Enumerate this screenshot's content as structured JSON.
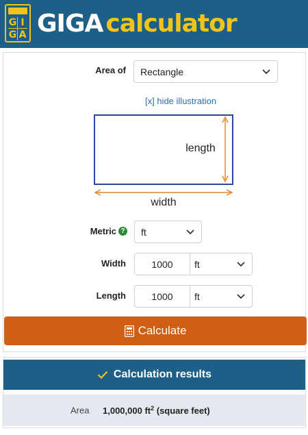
{
  "header": {
    "logo_letters": [
      "G",
      "I",
      "G",
      "A"
    ],
    "brand_part1": "GIGA",
    "brand_part2": "calculator"
  },
  "form": {
    "area_of_label": "Area of",
    "area_of_value": "Rectangle",
    "toggle_link": "[x] hide illustration",
    "illustration": {
      "length_label": "length",
      "width_label": "width"
    },
    "metric_label": "Metric",
    "metric_help": "?",
    "metric_value": "ft",
    "width_label": "Width",
    "width_value": "1000",
    "width_unit": "ft",
    "length_label": "Length",
    "length_value": "1000",
    "length_unit": "ft",
    "calculate_label": "Calculate"
  },
  "results": {
    "title": "Calculation results",
    "row_label": "Area",
    "row_value_number": "1,000,000 ft",
    "row_value_exp": "2",
    "row_value_suffix": " (square feet)"
  },
  "colors": {
    "header_bg": "#1d5f86",
    "brand_yellow": "#f0c419",
    "button_orange": "#cf5f13",
    "arrow_orange": "#e0872d",
    "rect_border": "#2a4aa0",
    "link_blue": "#2a6fb0"
  },
  "icons": {
    "chevron": "chevron-down-icon",
    "help": "help-icon",
    "calculator": "calculator-icon",
    "check": "check-icon"
  }
}
